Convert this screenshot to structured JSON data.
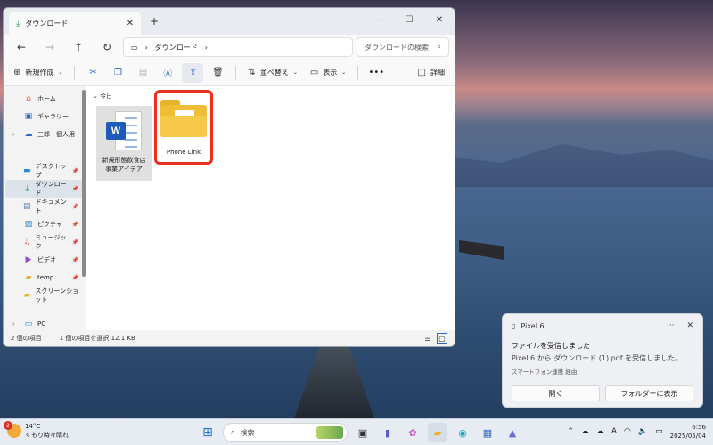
{
  "explorer": {
    "tab_title": "ダウンロード",
    "breadcrumb": "ダウンロード",
    "search_placeholder": "ダウンロードの検索",
    "toolbar": {
      "new_label": "新規作成",
      "sort_label": "並べ替え",
      "view_label": "表示",
      "details_label": "詳細"
    },
    "nav": {
      "home": "ホーム",
      "gallery": "ギャラリー",
      "onedrive": "三郎 - 個人用",
      "desktop": "デスクトップ",
      "downloads": "ダウンロード",
      "documents": "ドキュメント",
      "pictures": "ピクチャ",
      "music": "ミュージック",
      "videos": "ビデオ",
      "temp": "temp",
      "screenshots": "スクリーンショット",
      "pc": "PC"
    },
    "group_label": "今日",
    "files": [
      {
        "name_line1": "新規形態飲食店",
        "name_line2": "事業アイデア"
      },
      {
        "name": "Phone Link"
      }
    ],
    "status": {
      "count": "2 個の項目",
      "selected": "1 個の項目を選択  12.1 KB"
    }
  },
  "toast": {
    "app": "Pixel 6",
    "title": "ファイルを受信しました",
    "message": "Pixel 6 から ダウンロード (1).pdf を受信しました。",
    "source": "スマートフォン連携 経由",
    "open_label": "開く",
    "folder_label": "フォルダーに表示"
  },
  "taskbar": {
    "weather_badge": "2",
    "temperature": "14°C",
    "condition": "くもり時々晴れ",
    "search_label": "検索",
    "ime": "A",
    "time": "6:56",
    "date": "2025/05/04"
  }
}
